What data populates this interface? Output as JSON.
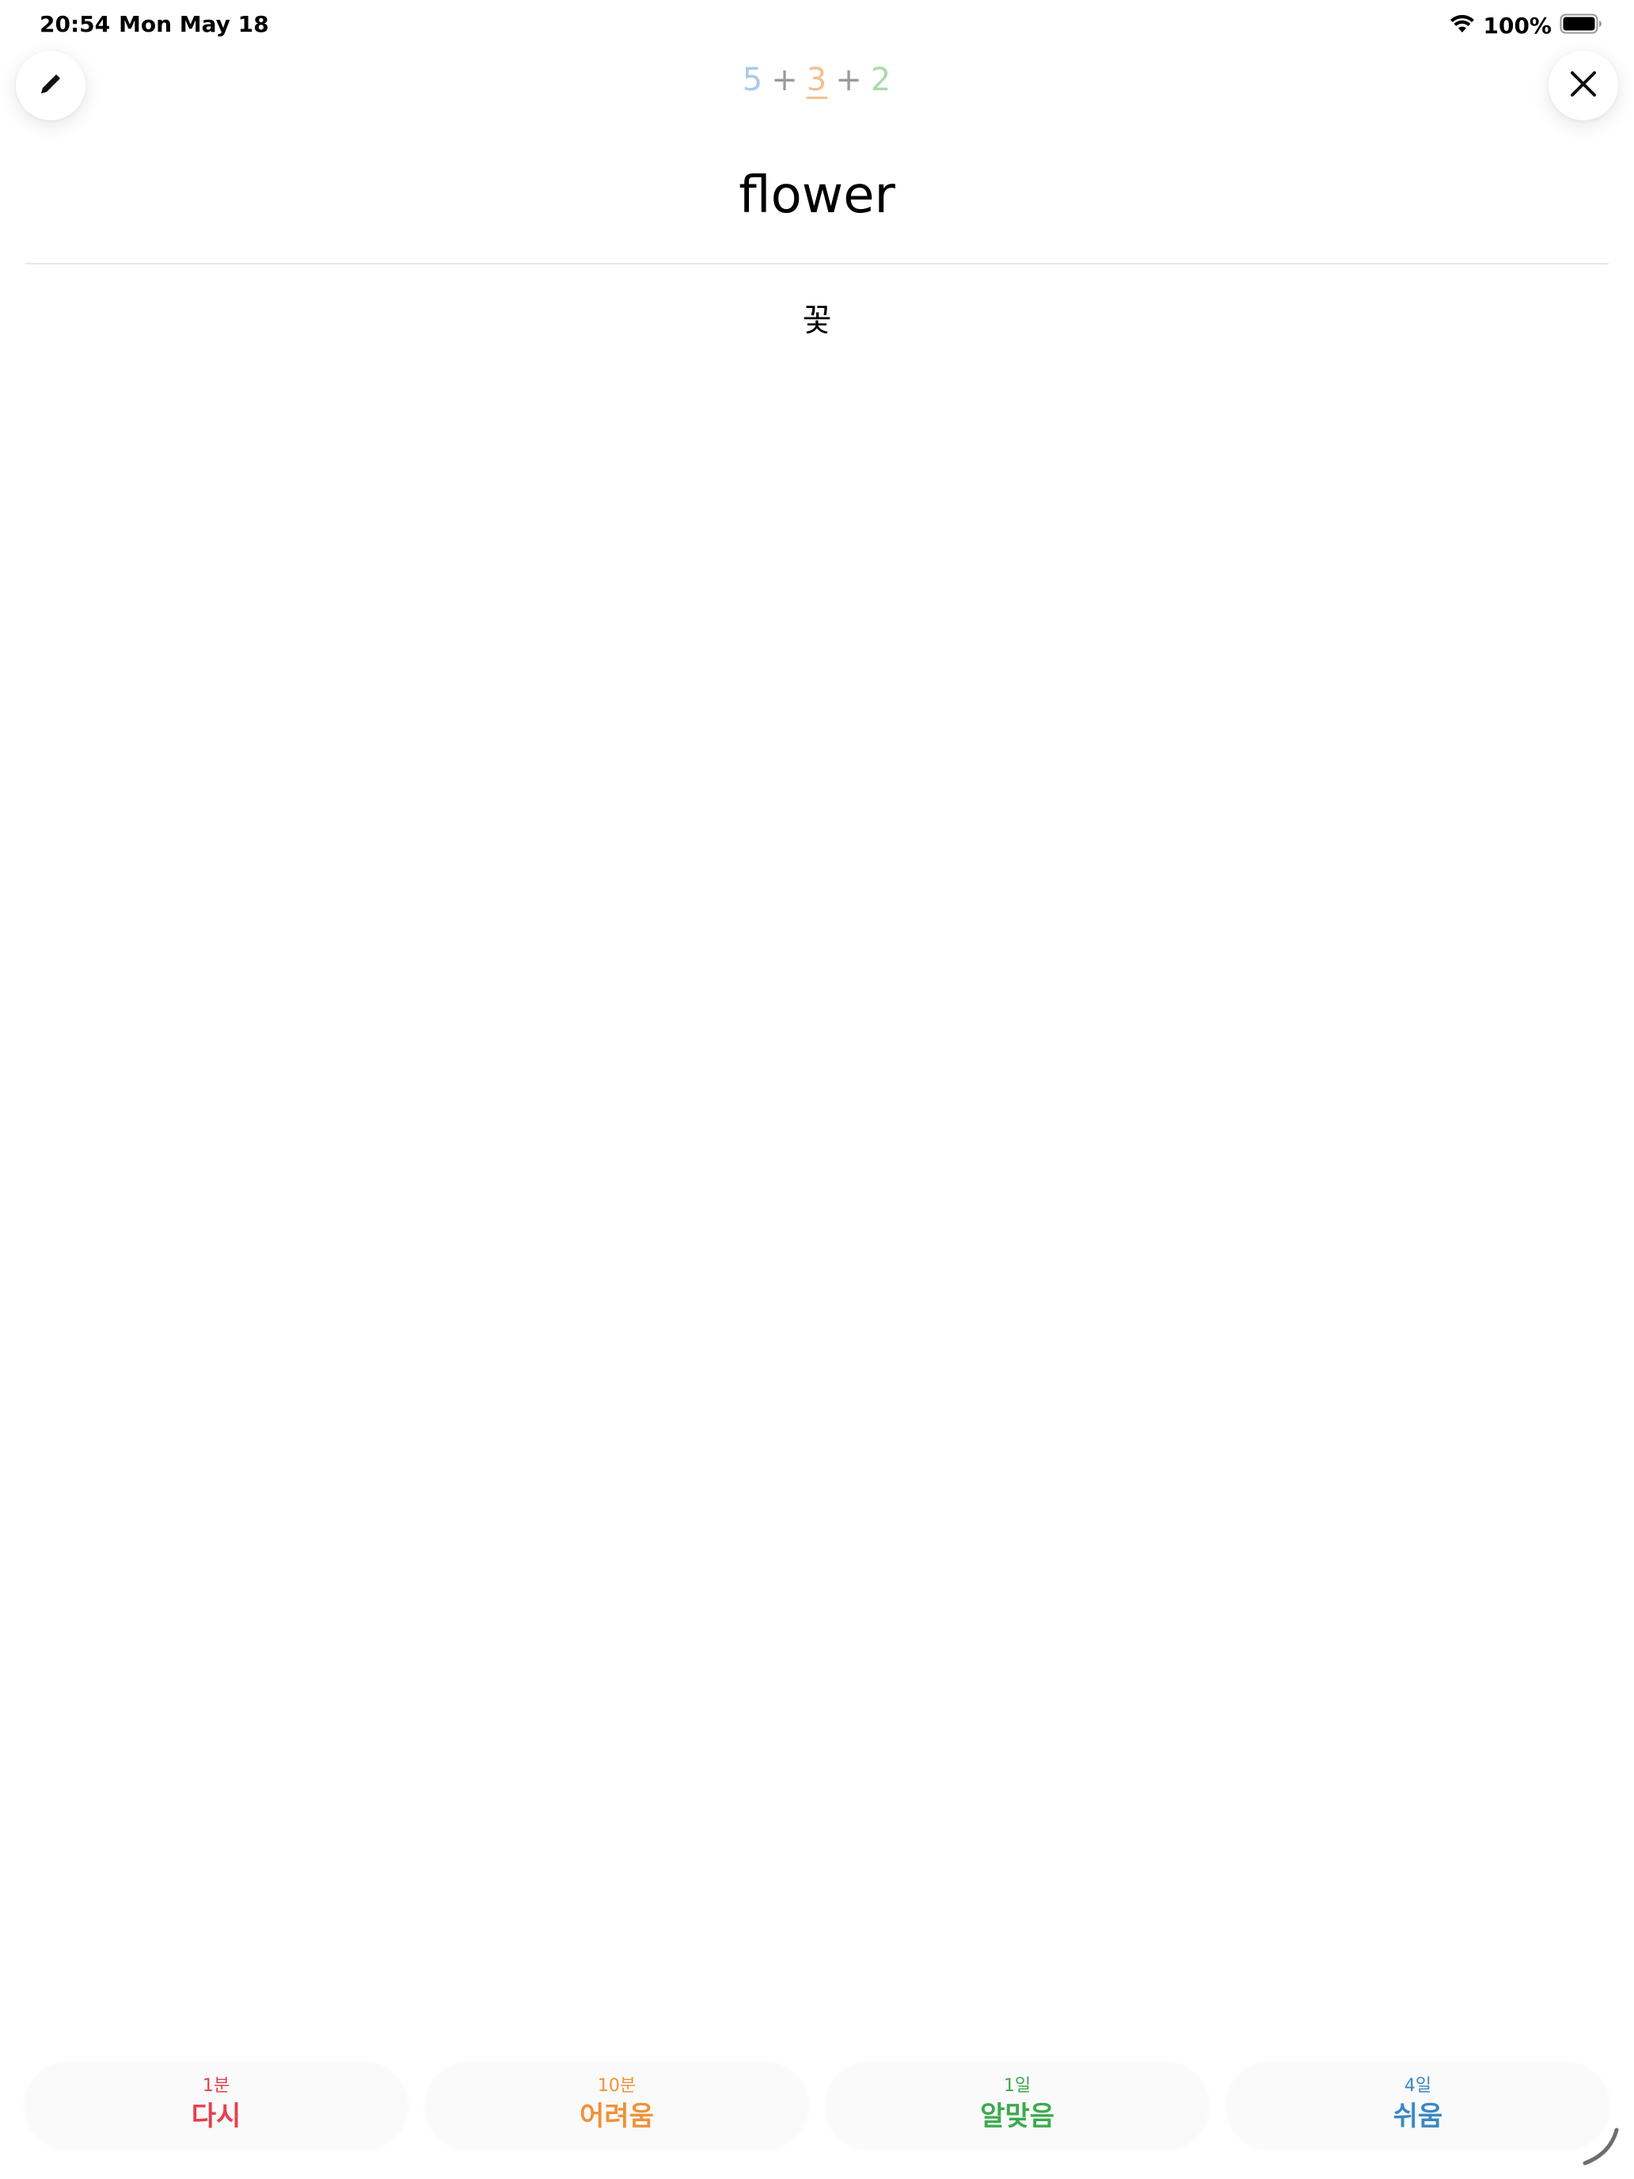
{
  "status_bar": {
    "time": "20:54",
    "date": "Mon May 18",
    "battery": "100%"
  },
  "toolbar": {
    "edit_icon": "pencil-icon",
    "close_icon": "close-icon"
  },
  "counter": {
    "new": "5",
    "learning": "3",
    "review": "2",
    "separator": "+",
    "colors": {
      "new": "#a9cbe8",
      "learning": "#f4c090",
      "review": "#a9dca9"
    }
  },
  "card": {
    "front": "flower",
    "back": "꽃"
  },
  "answers": [
    {
      "interval": "1분",
      "label": "다시",
      "color": "#e5404c"
    },
    {
      "interval": "10분",
      "label": "어려움",
      "color": "#f0923a"
    },
    {
      "interval": "1일",
      "label": "알맞음",
      "color": "#3caa4e"
    },
    {
      "interval": "4일",
      "label": "쉬움",
      "color": "#3a88c4"
    }
  ]
}
